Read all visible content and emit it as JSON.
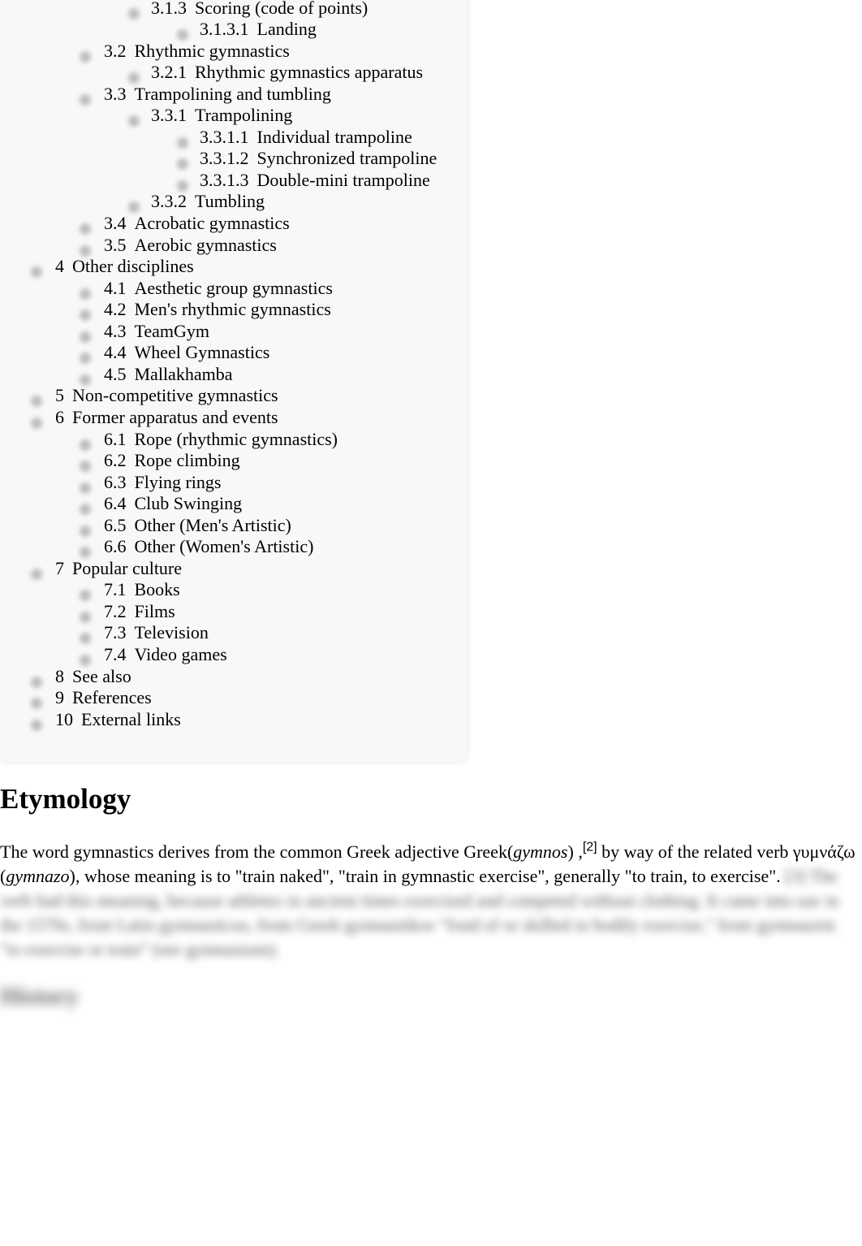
{
  "toc": [
    {
      "num": "3.1.3",
      "label": "Scoring (code of points)",
      "level": 3
    },
    {
      "num": "3.1.3.1",
      "label": "Landing",
      "level": 4
    },
    {
      "num": "3.2",
      "label": "Rhythmic gymnastics",
      "level": 2
    },
    {
      "num": "3.2.1",
      "label": "Rhythmic gymnastics apparatus",
      "level": 3
    },
    {
      "num": "3.3",
      "label": "Trampolining and tumbling",
      "level": 2
    },
    {
      "num": "3.3.1",
      "label": "Trampolining",
      "level": 3
    },
    {
      "num": "3.3.1.1",
      "label": "Individual trampoline",
      "level": 4
    },
    {
      "num": "3.3.1.2",
      "label": "Synchronized trampoline",
      "level": 4
    },
    {
      "num": "3.3.1.3",
      "label": "Double-mini trampoline",
      "level": 4
    },
    {
      "num": "3.3.2",
      "label": "Tumbling",
      "level": 3
    },
    {
      "num": "3.4",
      "label": "Acrobatic gymnastics",
      "level": 2
    },
    {
      "num": "3.5",
      "label": "Aerobic gymnastics",
      "level": 2
    },
    {
      "num": "4",
      "label": "Other disciplines",
      "level": 1
    },
    {
      "num": "4.1",
      "label": "Aesthetic group gymnastics",
      "level": 2
    },
    {
      "num": "4.2",
      "label": "Men's rhythmic gymnastics",
      "level": 2
    },
    {
      "num": "4.3",
      "label": "TeamGym",
      "level": 2
    },
    {
      "num": "4.4",
      "label": "Wheel Gymnastics",
      "level": 2
    },
    {
      "num": "4.5",
      "label": "Mallakhamba",
      "level": 2
    },
    {
      "num": "5",
      "label": "Non-competitive gymnastics",
      "level": 1
    },
    {
      "num": "6",
      "label": "Former apparatus and events",
      "level": 1
    },
    {
      "num": "6.1",
      "label": "Rope (rhythmic gymnastics)",
      "level": 2
    },
    {
      "num": "6.2",
      "label": "Rope climbing",
      "level": 2
    },
    {
      "num": "6.3",
      "label": "Flying rings",
      "level": 2
    },
    {
      "num": "6.4",
      "label": "Club Swinging",
      "level": 2
    },
    {
      "num": "6.5",
      "label": "Other (Men's Artistic)",
      "level": 2
    },
    {
      "num": "6.6",
      "label": "Other (Women's Artistic)",
      "level": 2
    },
    {
      "num": "7",
      "label": "Popular culture",
      "level": 1
    },
    {
      "num": "7.1",
      "label": "Books",
      "level": 2
    },
    {
      "num": "7.2",
      "label": "Films",
      "level": 2
    },
    {
      "num": "7.3",
      "label": "Television",
      "level": 2
    },
    {
      "num": "7.4",
      "label": "Video games",
      "level": 2
    },
    {
      "num": "8",
      "label": "See also",
      "level": 1
    },
    {
      "num": "9",
      "label": "References",
      "level": 1
    },
    {
      "num": "10",
      "label": "External links",
      "level": 1
    }
  ],
  "etymology": {
    "title": "Etymology",
    "p1": "The word gymnastics derives from the common Greek adjective Greek(",
    "gymnos": "gymnos",
    "p2": ") ,",
    "ref": "[2]",
    "p3": " by way of the related verb γυμνάζω (",
    "gymnazo": "gymnazo",
    "p4": "), whose meaning is to \"train naked\", \"train in gymnastic exercise\", generally \"to train, to exercise\".",
    "blurred": "[3] The verb had this meaning, because athletes in ancient times exercised and competed without clothing. It came into use in the 1570s, from Latin gymnasticus, from Greek gymnastikos \"fond of or skilled in bodily exercise,\" from gymnazein \"to exercise or train\" (see gymnasium)."
  },
  "next_section": "History"
}
